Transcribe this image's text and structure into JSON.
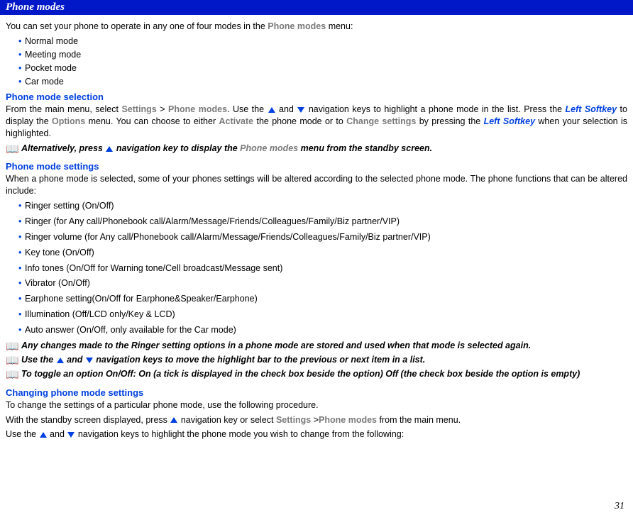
{
  "title": "Phone modes",
  "intro_pre": "You can set your phone to operate in any one of four modes in the ",
  "intro_gray": "Phone modes",
  "intro_post": " menu:",
  "modes": [
    "Normal mode",
    "Meeting mode",
    "Pocket mode",
    "Car mode"
  ],
  "sec1": {
    "heading": "Phone mode selection",
    "p1a": "From the main menu, select ",
    "p1_settings": "Settings",
    "p1b": " > ",
    "p1_phonemodes": "Phone modes",
    "p1c": ". Use the ",
    "p1d": " and ",
    "p1e": " navigation keys to highlight a phone mode in the list. Press the ",
    "p1_leftsoft1": "Left Softkey",
    "p1f": " to display the ",
    "p1_options": "Options",
    "p1g": " menu. You can choose to either ",
    "p1_activate": "Activate",
    "p1h": " the phone mode or to ",
    "p1_change": "Change settings",
    "p1i": " by pressing the ",
    "p1_leftsoft2": "Left Softkey",
    "p1j": " when your selection is highlighted.",
    "note_a": "Alternatively, press  ",
    "note_b": " navigation key to display the ",
    "note_gray": "Phone modes",
    "note_c": " menu from the standby screen."
  },
  "sec2": {
    "heading": "Phone mode settings",
    "p1": "When a phone mode is selected, some of your phones settings will be altered according to the selected phone mode. The phone functions that can be altered include:",
    "items": [
      "Ringer setting (On/Off)",
      "Ringer (for Any call/Phonebook call/Alarm/Message/Friends/Colleagues/Family/Biz partner/VIP)",
      "Ringer volume (for Any call/Phonebook call/Alarm/Message/Friends/Colleagues/Family/Biz partner/VIP)",
      "Key tone (On/Off)",
      "Info tones (On/Off for Warning tone/Cell broadcast/Message sent)",
      "Vibrator (On/Off)",
      "Earphone setting(On/Off for Earphone&Speaker/Earphone)",
      "Illumination  (Off/LCD only/Key & LCD)",
      "Auto answer (On/Off, only available for the Car mode)"
    ],
    "note1": "Any changes made to the Ringer setting options in a phone mode are stored and used when that mode is selected again.",
    "note2a": "Use the ",
    "note2b": " and ",
    "note2c": " navigation ",
    "note2d": "keys to move the highlight bar to the previous or next item in a list.",
    "note3": "To toggle an option On/Off: On (a tick is displayed in the check box beside the option) Off (the check box beside the option is empty)"
  },
  "sec3": {
    "heading": "Changing phone mode settings",
    "p1": "To change the settings of a particular phone mode, use the following procedure.",
    "p2a": "With the standby screen displayed, press ",
    "p2b": " navigation key or select ",
    "p2_settings": "Settings",
    "p2c": " >",
    "p2_phonemodes": "Phone modes",
    "p2d": " from the main menu.",
    "p3a": "Use the ",
    "p3b": " and ",
    "p3c": " navigation keys to highlight the phone mode you wish to change from the following:"
  },
  "page_number": "31"
}
